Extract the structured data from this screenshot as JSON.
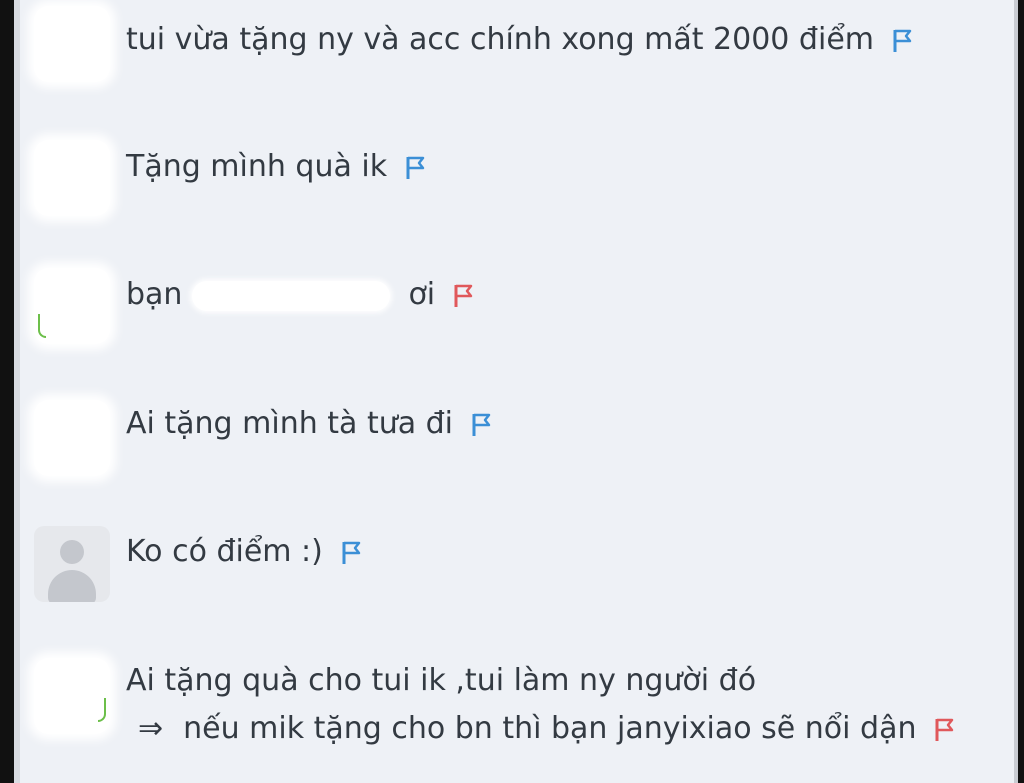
{
  "comments": [
    {
      "text": "tui vừa tặng ny và acc chính xong mất 2000 điểm",
      "flag_color": "#3b8fd6",
      "flag_icon": "flag-icon"
    },
    {
      "text": "Tặng mình quà ik",
      "flag_color": "#3b8fd6",
      "flag_icon": "flag-icon"
    },
    {
      "text_before": "bạn",
      "text_after": "ơi",
      "flag_color": "#e0585b",
      "flag_icon": "flag-icon"
    },
    {
      "text": "Ai tặng mình tà tưa đi",
      "flag_color": "#3b8fd6",
      "flag_icon": "flag-icon"
    },
    {
      "text": "Ko có điểm :)",
      "flag_color": "#3b8fd6",
      "flag_icon": "flag-icon",
      "avatar": "default-avatar-icon"
    },
    {
      "text": "Ai tặng quà cho tui ik ,tui làm ny người đó",
      "reply_arrow": "⇒",
      "reply_text": "nếu mik tặng cho bn thì bạn janyixiao sẽ nổi dận",
      "flag_color": "#e0585b",
      "flag_icon": "flag-icon"
    }
  ]
}
